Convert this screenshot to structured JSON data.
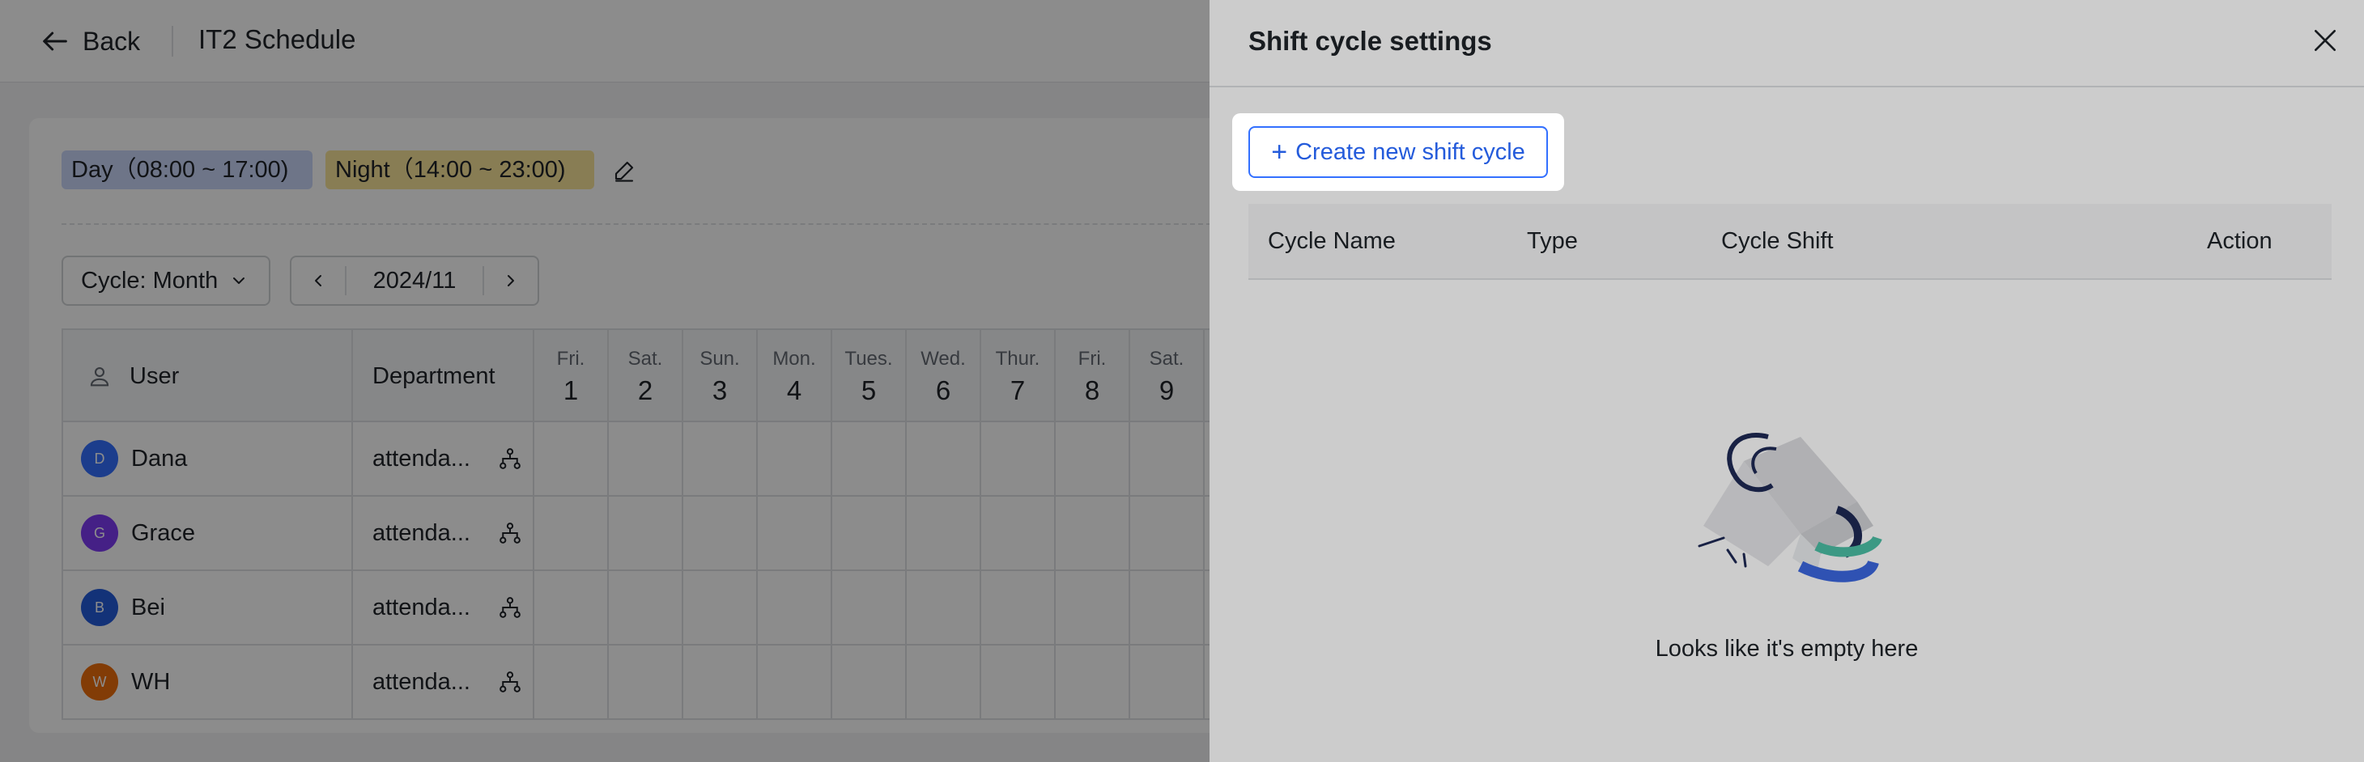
{
  "header": {
    "back_label": "Back",
    "title": "IT2 Schedule"
  },
  "shifts": [
    {
      "label": "Day（08:00 ~ 17:00)",
      "color": "#c9d6f7"
    },
    {
      "label": "Night（14:00 ~ 23:00)",
      "color": "#f8e39a"
    }
  ],
  "toolbar": {
    "cycle_select": "Cycle: Month",
    "month": "2024/11"
  },
  "grid": {
    "user_header": "User",
    "department_header": "Department",
    "days": [
      {
        "dow": "Fri.",
        "num": "1"
      },
      {
        "dow": "Sat.",
        "num": "2"
      },
      {
        "dow": "Sun.",
        "num": "3"
      },
      {
        "dow": "Mon.",
        "num": "4"
      },
      {
        "dow": "Tues.",
        "num": "5"
      },
      {
        "dow": "Wed.",
        "num": "6"
      },
      {
        "dow": "Thur.",
        "num": "7"
      },
      {
        "dow": "Fri.",
        "num": "8"
      },
      {
        "dow": "Sat.",
        "num": "9"
      }
    ],
    "rows": [
      {
        "initial": "D",
        "name": "Dana",
        "dept": "attenda...",
        "color": "#3370ff"
      },
      {
        "initial": "G",
        "name": "Grace",
        "dept": "attenda...",
        "color": "#7f3bf5"
      },
      {
        "initial": "B",
        "name": "Bei",
        "dept": "attenda...",
        "color": "#245bdb"
      },
      {
        "initial": "W",
        "name": "WH",
        "dept": "attenda...",
        "color": "#ed6d0c"
      }
    ]
  },
  "drawer": {
    "title": "Shift cycle settings",
    "create_button": "Create new shift cycle",
    "columns": {
      "name": "Cycle Name",
      "type": "Type",
      "shift": "Cycle Shift",
      "action": "Action"
    },
    "empty_text": "Looks like it's empty here"
  }
}
